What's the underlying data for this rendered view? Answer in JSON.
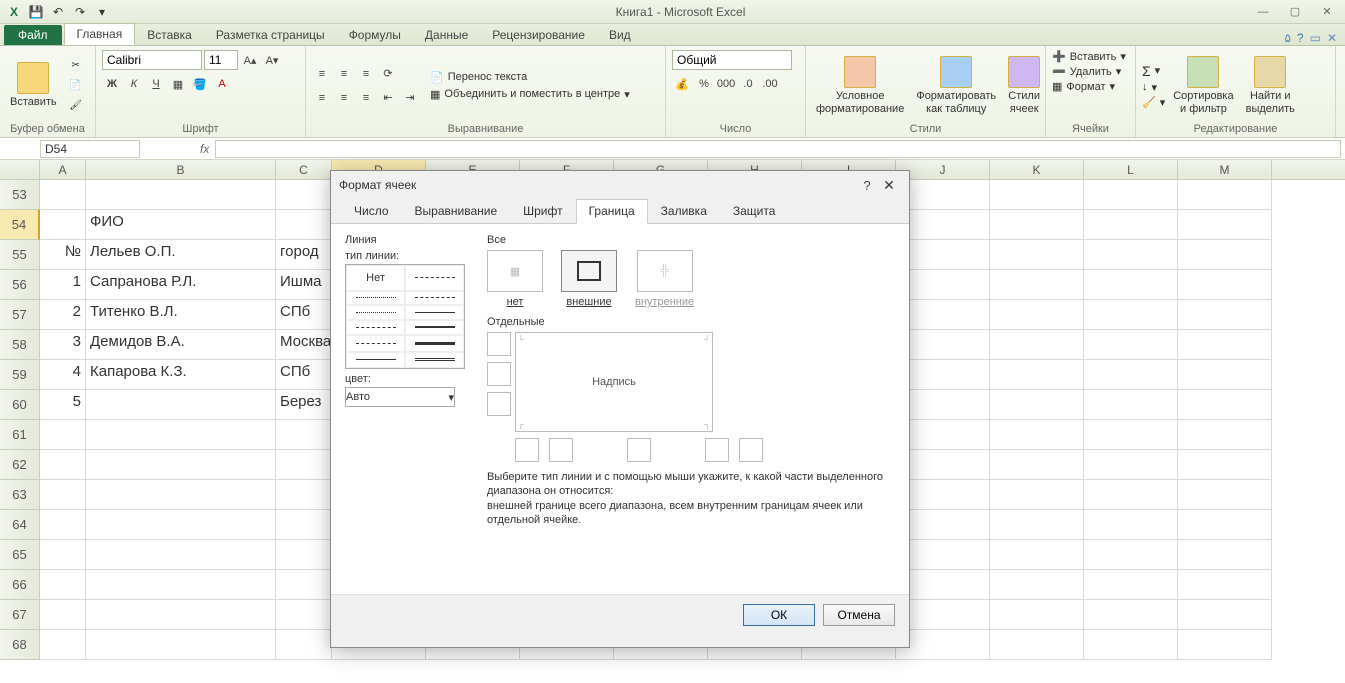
{
  "title": "Книга1  -  Microsoft Excel",
  "tabs": {
    "file": "Файл",
    "list": [
      "Главная",
      "Вставка",
      "Разметка страницы",
      "Формулы",
      "Данные",
      "Рецензирование",
      "Вид"
    ],
    "active": 0
  },
  "ribbon": {
    "clipboard": {
      "paste": "Вставить",
      "label": "Буфер обмена"
    },
    "font": {
      "name": "Calibri",
      "size": "11",
      "label": "Шрифт",
      "bold": "Ж",
      "italic": "К",
      "underline": "Ч"
    },
    "alignment": {
      "wrap": "Перенос текста",
      "merge": "Объединить и поместить в центре",
      "label": "Выравнивание"
    },
    "number": {
      "format": "Общий",
      "label": "Число"
    },
    "styles": {
      "cond": "Условное\nформатирование",
      "table": "Форматировать\nкак таблицу",
      "styles": "Стили\nячеек",
      "label": "Стили"
    },
    "cells": {
      "insert": "Вставить",
      "delete": "Удалить",
      "format": "Формат",
      "label": "Ячейки"
    },
    "editing": {
      "sort": "Сортировка\nи фильтр",
      "find": "Найти и\nвыделить",
      "label": "Редактирование"
    }
  },
  "namebox": "D54",
  "fx": "fx",
  "columns": [
    "A",
    "B",
    "C",
    "D",
    "E",
    "F",
    "G",
    "H",
    "I",
    "J",
    "K",
    "L",
    "M"
  ],
  "rows": [
    "53",
    "54",
    "55",
    "56",
    "57",
    "58",
    "59",
    "60",
    "61",
    "62",
    "63",
    "64",
    "65",
    "66",
    "67",
    "68"
  ],
  "active_row": 1,
  "sheet": {
    "r53": {
      "A": "",
      "B": "",
      "C": ""
    },
    "r54": {
      "A": "",
      "B": "ФИО",
      "C": ""
    },
    "r55": {
      "A": "№",
      "B": "Лельев О.П.",
      "C": "город"
    },
    "r56": {
      "A": "1",
      "B": "Сапранова Р.Л.",
      "C": "Ишма"
    },
    "r57": {
      "A": "2",
      "B": "Титенко В.Л.",
      "C": "СПб"
    },
    "r58": {
      "A": "3",
      "B": "Демидов В.А.",
      "C": "Москва"
    },
    "r59": {
      "A": "4",
      "B": "Капарова К.З.",
      "C": "СПб"
    },
    "r60": {
      "A": "5",
      "B": "",
      "C": "Берез"
    }
  },
  "dialog": {
    "title": "Формат ячеек",
    "tabs": [
      "Число",
      "Выравнивание",
      "Шрифт",
      "Граница",
      "Заливка",
      "Защита"
    ],
    "active_tab": 3,
    "line_section": "Линия",
    "line_type": "тип линии:",
    "none_style": "Нет",
    "color_label": "цвет:",
    "color_value": "Авто",
    "all_section": "Все",
    "presets": {
      "none": "нет",
      "outer": "внешние",
      "inner": "внутренние"
    },
    "separate_section": "Отдельные",
    "preview_text": "Надпись",
    "help_line1": "Выберите тип линии и с помощью мыши укажите, к какой части выделенного диапазона он относится:",
    "help_line2": "внешней границе всего диапазона, всем внутренним границам ячеек или отдельной ячейке.",
    "ok": "ОК",
    "cancel": "Отмена"
  }
}
